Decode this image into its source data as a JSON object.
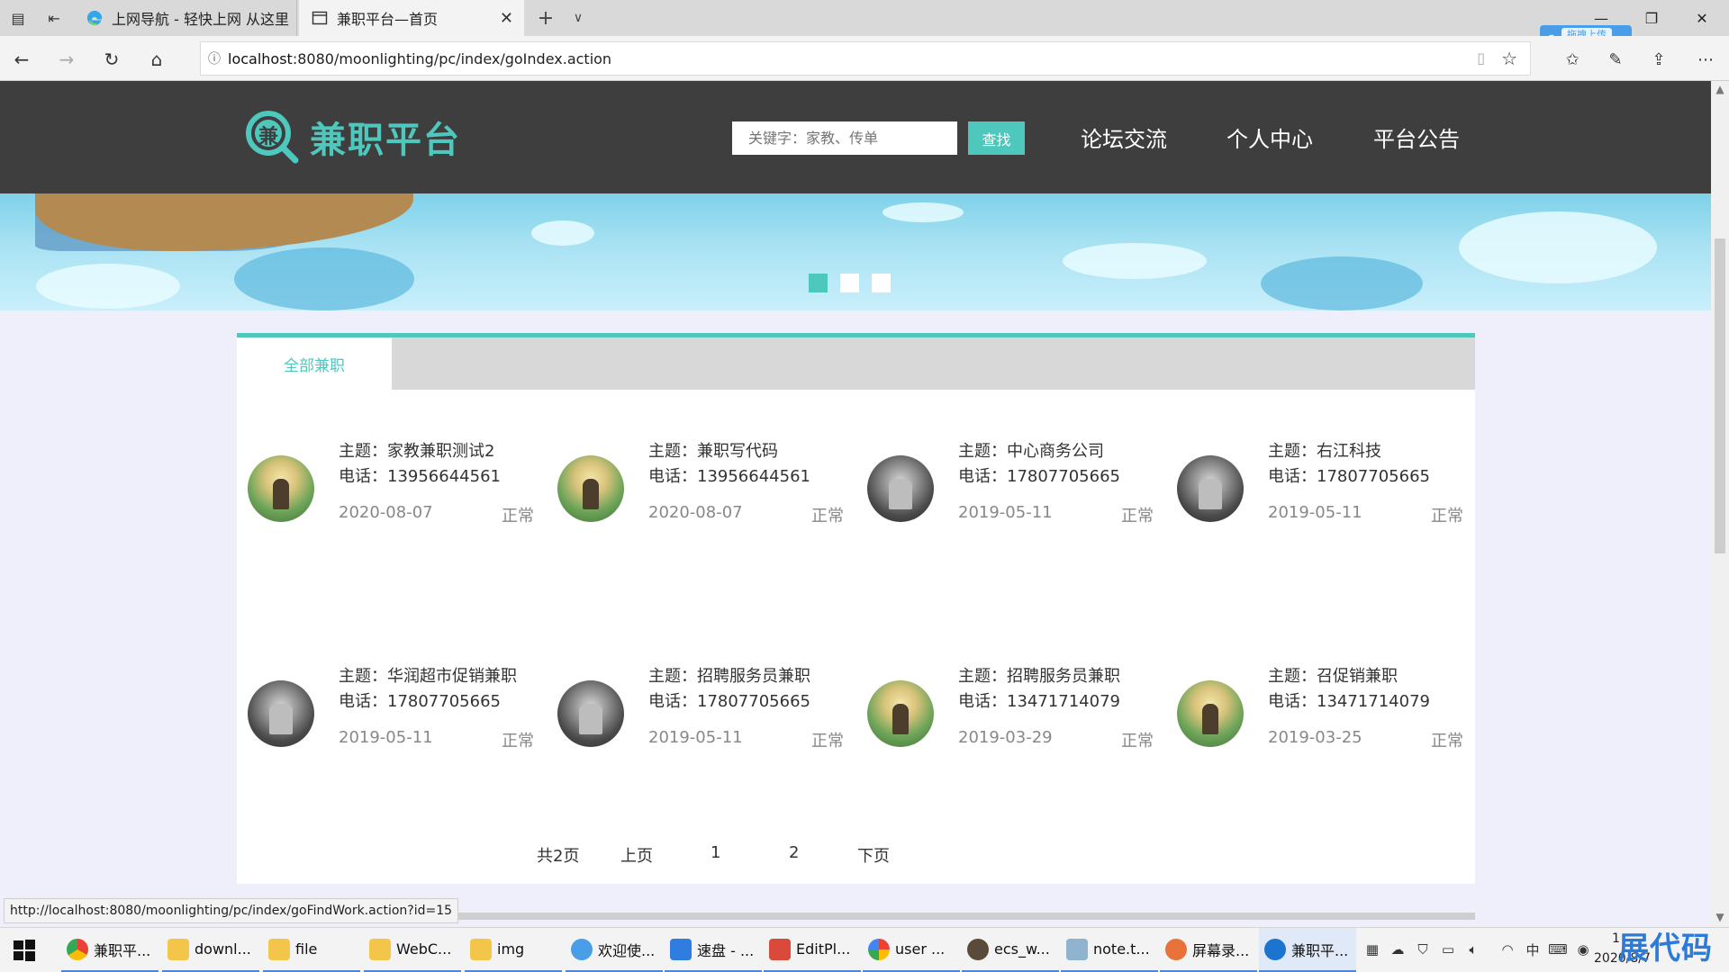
{
  "browser": {
    "tabs": [
      {
        "label": "上网导航 - 轻快上网 从这里"
      },
      {
        "label": "兼职平台—首页"
      }
    ],
    "url_host": "localhost",
    "url_rest": ":8080/moonlighting/pc/index/goIndex.action",
    "upload_badge": "拖拽上传",
    "status_url": "http://localhost:8080/moonlighting/pc/index/goFindWork.action?id=15"
  },
  "site": {
    "logo_char": "兼",
    "logo_text": "兼职平台",
    "search_placeholder": "关键字：家教、传单",
    "search_button": "查找",
    "nav": [
      "论坛交流",
      "个人中心",
      "平台公告"
    ]
  },
  "panel": {
    "tab_label": "全部兼职",
    "jobs": [
      {
        "title": "主题：家教兼职测试2",
        "phone": "电话：13956644561",
        "date": "2020-08-07",
        "status": "正常",
        "avatar": "kids"
      },
      {
        "title": "主题：兼职写代码",
        "phone": "电话：13956644561",
        "date": "2020-08-07",
        "status": "正常",
        "avatar": "kids"
      },
      {
        "title": "主题：中心商务公司",
        "phone": "电话：17807705665",
        "date": "2019-05-11",
        "status": "正常",
        "avatar": "knight"
      },
      {
        "title": "主题：右江科技",
        "phone": "电话：17807705665",
        "date": "2019-05-11",
        "status": "正常",
        "avatar": "knight"
      },
      {
        "title": "主题：华润超市促销兼职",
        "phone": "电话：17807705665",
        "date": "2019-05-11",
        "status": "正常",
        "avatar": "knight"
      },
      {
        "title": "主题：招聘服务员兼职",
        "phone": "电话：17807705665",
        "date": "2019-05-11",
        "status": "正常",
        "avatar": "knight"
      },
      {
        "title": "主题：招聘服务员兼职",
        "phone": "电话：13471714079",
        "date": "2019-03-29",
        "status": "正常",
        "avatar": "kids"
      },
      {
        "title": "主题：召促销兼职",
        "phone": "电话：13471714079",
        "date": "2019-03-25",
        "status": "正常",
        "avatar": "kids"
      }
    ],
    "pager": {
      "total": "共2页",
      "prev": "上页",
      "page1": "1",
      "page2": "2",
      "next": "下页"
    }
  },
  "taskbar": {
    "items": [
      "兼职平...",
      "downl...",
      "file",
      "WebC...",
      "img",
      "欢迎使...",
      "速盘 - ...",
      "EditPl...",
      "user ...",
      "ecs_w...",
      "note.t...",
      "屏幕录...",
      "兼职平..."
    ],
    "ime": "中",
    "clock_time": "1",
    "clock_date": "2020/8/7",
    "watermark": "展代码"
  },
  "colors": {
    "accent": "#4ec7bd",
    "header_bg": "#3e3e3e",
    "page_bg": "#efeffb"
  }
}
